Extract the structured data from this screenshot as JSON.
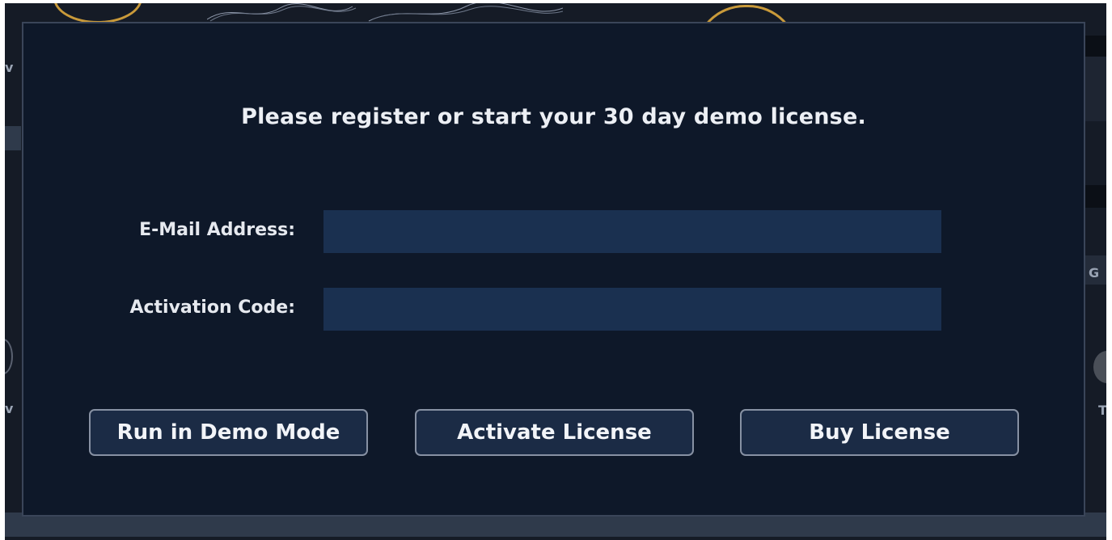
{
  "dialog": {
    "title": "Please register or start your 30 day demo license.",
    "email": {
      "label": "E-Mail Address:",
      "value": "",
      "placeholder": ""
    },
    "activation": {
      "label": "Activation Code:",
      "value": "",
      "placeholder": ""
    },
    "buttons": {
      "demo": "Run in Demo Mode",
      "activate": "Activate License",
      "buy": "Buy License"
    }
  },
  "background": {
    "edge_letters": {
      "left_top": "v",
      "left_bottom": "v",
      "right_middle": "G",
      "right_bottom": "T"
    }
  },
  "colors": {
    "dialog_bg": "#0e1829",
    "input_bg": "#1a3050",
    "button_bg": "#1b2b45",
    "button_border": "#8791a3",
    "text": "#eceff4",
    "knob_accent": "#c99a3a",
    "knob_red": "#b23a2e"
  }
}
